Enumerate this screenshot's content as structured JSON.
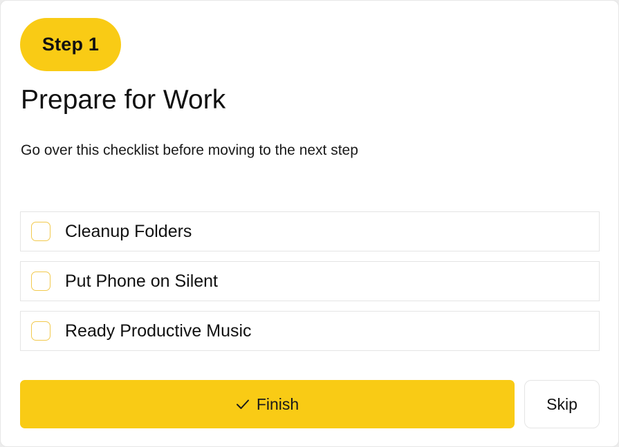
{
  "step": {
    "label": "Step 1"
  },
  "header": {
    "title": "Prepare for Work",
    "subtitle": "Go over this checklist before moving to the next step"
  },
  "checklist": {
    "items": [
      {
        "label": "Cleanup Folders",
        "checked": false
      },
      {
        "label": "Put Phone on Silent",
        "checked": false
      },
      {
        "label": "Ready Productive Music",
        "checked": false
      }
    ]
  },
  "actions": {
    "finish_label": "Finish",
    "finish_icon": "check-icon",
    "skip_label": "Skip"
  },
  "colors": {
    "accent": "#f9cb15",
    "checkbox_border": "#f2c94c",
    "text": "#111111",
    "border": "#e4e4e4"
  }
}
